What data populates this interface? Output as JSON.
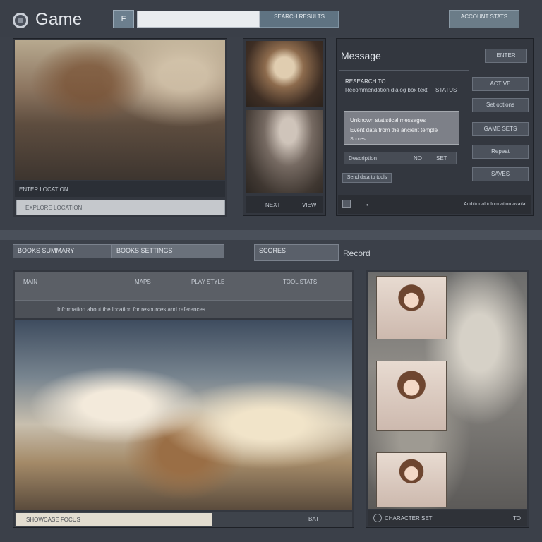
{
  "app": {
    "title": "Game",
    "search_tag": "F",
    "search_placeholder": "",
    "search_button": "SEARCH RESULTS",
    "account_button": "ACCOUNT STATS"
  },
  "gallery": {
    "main_caption": "ENTER LOCATION",
    "main_action": "EXPLORE LOCATION",
    "thumb_footer": [
      "NEXT",
      "VIEW"
    ]
  },
  "info_panel": {
    "title": "Message",
    "header_button": "ENTER",
    "section_title": "RESEARCH TO",
    "section_line": "Recommendation dialog box text",
    "section_status": "STATUS",
    "highlight_line1": "Unknown statistical messages",
    "highlight_line2": "Event data from the ancient temple",
    "highlight_line3": "Scores",
    "field_label": "Description",
    "field_value": "NO",
    "field_button": "SET",
    "small_button": "Send data to tools",
    "footer_text": "Additional information available",
    "side_buttons": [
      "ACTIVE",
      "Set options",
      "GAME SETS",
      "Repeat",
      "SAVES"
    ]
  },
  "lower": {
    "tab_left": "BOOKS SUMMARY",
    "tab_right": "BOOKS SETTINGS",
    "tab_third": "SCORES",
    "heading": "Record",
    "toolbar": [
      "MAIN",
      "MAPS",
      "PLAY STYLE",
      "TOOL STATS"
    ],
    "subtitle": "Information about the location for resources and references",
    "footer_caption": "SHOWCASE FOCUS",
    "footer_value": "BAT",
    "portrait_footer": "CHARACTER SET",
    "portrait_footer_value": "TO"
  }
}
